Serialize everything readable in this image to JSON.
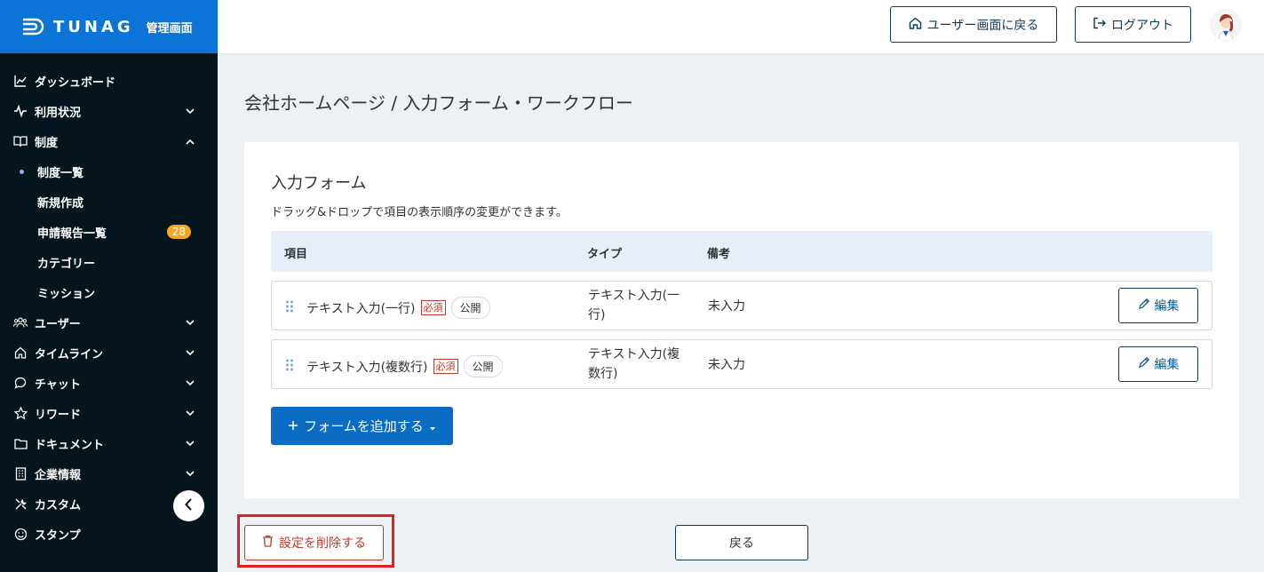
{
  "brand": {
    "name": "TUNAG",
    "sub": "管理画面",
    "color": "#0b74d6"
  },
  "sidebar": {
    "items": [
      {
        "label": "ダッシュボード",
        "icon": "chart-line-icon"
      },
      {
        "label": "利用状況",
        "icon": "activity-icon"
      },
      {
        "label": "制度",
        "icon": "book-icon"
      },
      {
        "label": "ユーザー",
        "icon": "users-icon"
      },
      {
        "label": "タイムライン",
        "icon": "home-icon"
      },
      {
        "label": "チャット",
        "icon": "chat-bubble-icon"
      },
      {
        "label": "リワード",
        "icon": "star-icon"
      },
      {
        "label": "ドキュメント",
        "icon": "folder-icon"
      },
      {
        "label": "企業情報",
        "icon": "building-icon"
      },
      {
        "label": "カスタム",
        "icon": "tools-icon"
      },
      {
        "label": "スタンプ",
        "icon": "smile-icon"
      }
    ],
    "sub_items": [
      {
        "label": "制度一覧",
        "active": true
      },
      {
        "label": "新規作成"
      },
      {
        "label": "申請報告一覧",
        "badge": "28"
      },
      {
        "label": "カテゴリー"
      },
      {
        "label": "ミッション"
      }
    ]
  },
  "header": {
    "user_screen_label": "ユーザー画面に戻る",
    "logout_label": "ログアウト"
  },
  "page": {
    "title": "会社ホームページ / 入力フォーム・ワークフロー"
  },
  "form": {
    "title": "入力フォーム",
    "description": "ドラッグ&ドロップで項目の表示順序の変更ができます。",
    "columns": {
      "item": "項目",
      "type": "タイプ",
      "note": "備考"
    },
    "rows": [
      {
        "name": "テキスト入力(一行)",
        "required": "必須",
        "visibility": "公開",
        "type_line1": "テキスト入力(一",
        "type_line2": "行)",
        "note": "未入力",
        "edit": "編集"
      },
      {
        "name": "テキスト入力(複数行)",
        "required": "必須",
        "visibility": "公開",
        "type_line1": "テキスト入力(複",
        "type_line2": "数行)",
        "note": "未入力",
        "edit": "編集"
      }
    ],
    "add_label": "フォームを追加する"
  },
  "footer": {
    "delete_label": "設定を削除する",
    "back_label": "戻る"
  }
}
